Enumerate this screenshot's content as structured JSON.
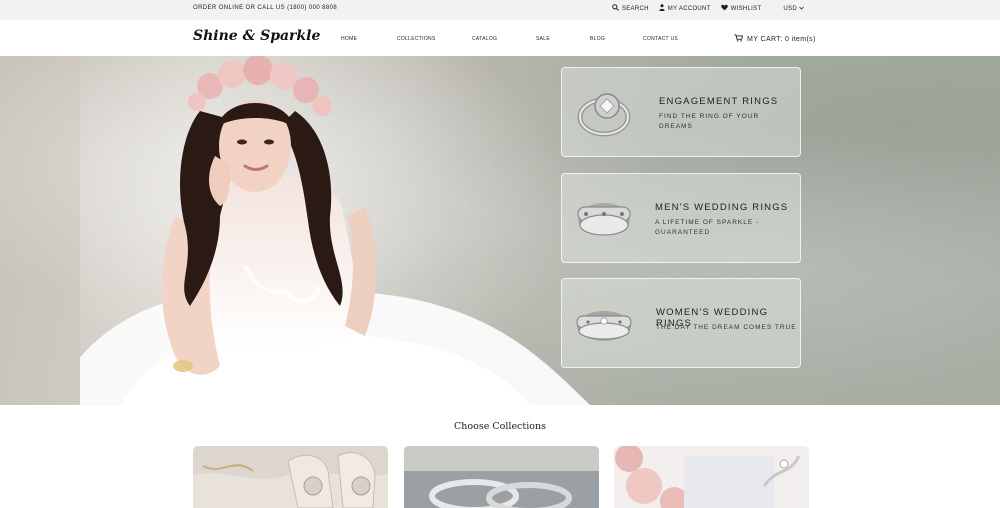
{
  "topbar": {
    "order_text": "ORDER ONLINE OR CALL US (1800) 000 8808",
    "search_label": "SEARCH",
    "account_label": "MY ACCOUNT",
    "wishlist_label": "WISHLIST",
    "currency": "USD"
  },
  "header": {
    "logo": "Shine & Sparkle",
    "nav": [
      "HOME",
      "COLLECTIONS",
      "CATALOG",
      "SALE",
      "BLOG",
      "CONTACT US"
    ],
    "cart_label": "MY CART:",
    "cart_count": "0 item(s)"
  },
  "hero": {
    "cards": [
      {
        "title": "ENGAGEMENT RINGS",
        "subtitle": "FIND THE RING OF YOUR DREAMS"
      },
      {
        "title": "MEN'S WEDDING RINGS",
        "subtitle": "A LIFETIME OF SPARKLE - GUARANTEED"
      },
      {
        "title": "WOMEN'S WEDDING RINGS",
        "subtitle": "THE DAY THE DREAM COMES TRUE"
      }
    ]
  },
  "collections": {
    "title": "Choose Collections"
  },
  "colors": {
    "topbar_bg": "#f2f2f2",
    "accent": "#222222"
  },
  "icons": {
    "search": "search-icon",
    "account": "user-icon",
    "wishlist": "heart-icon",
    "cart": "cart-icon"
  }
}
